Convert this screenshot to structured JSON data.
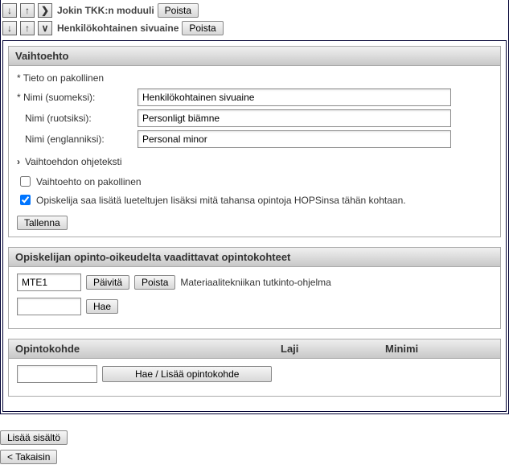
{
  "row1": {
    "label": "Jokin TKK:n moduuli",
    "remove": "Poista"
  },
  "row2": {
    "label": "Henkilökohtainen sivuaine",
    "remove": "Poista"
  },
  "option_panel": {
    "title": "Vaihtoehto",
    "mandatory_note": "* Tieto on pakollinen",
    "name_fi_label": "* Nimi (suomeksi):",
    "name_fi_value": "Henkilökohtainen sivuaine",
    "name_sv_label": "Nimi (ruotsiksi):",
    "name_sv_value": "Personligt biämne",
    "name_en_label": "Nimi (englanniksi):",
    "name_en_value": "Personal minor",
    "help_label": "Vaihtoehdon ohjeteksti",
    "mandatory_checkbox_label": "Vaihtoehto on pakollinen",
    "extra_checkbox_label": "Opiskelija saa lisätä lueteltujen lisäksi mitä tahansa opintoja HOPSinsa tähän kohtaan.",
    "save": "Tallenna"
  },
  "rights_panel": {
    "title": "Opiskelijan opinto-oikeudelta vaadittavat opintokohteet",
    "code_value": "MTE1",
    "update": "Päivitä",
    "remove": "Poista",
    "desc": "Materiaalitekniikan tutkinto-ohjelma",
    "search": "Hae"
  },
  "course_panel": {
    "col1": "Opintokohde",
    "col2": "Laji",
    "col3": "Minimi",
    "add_btn": "Hae / Lisää opintokohde"
  },
  "footer": {
    "add_content": "Lisää sisältö",
    "back": "< Takaisin"
  }
}
